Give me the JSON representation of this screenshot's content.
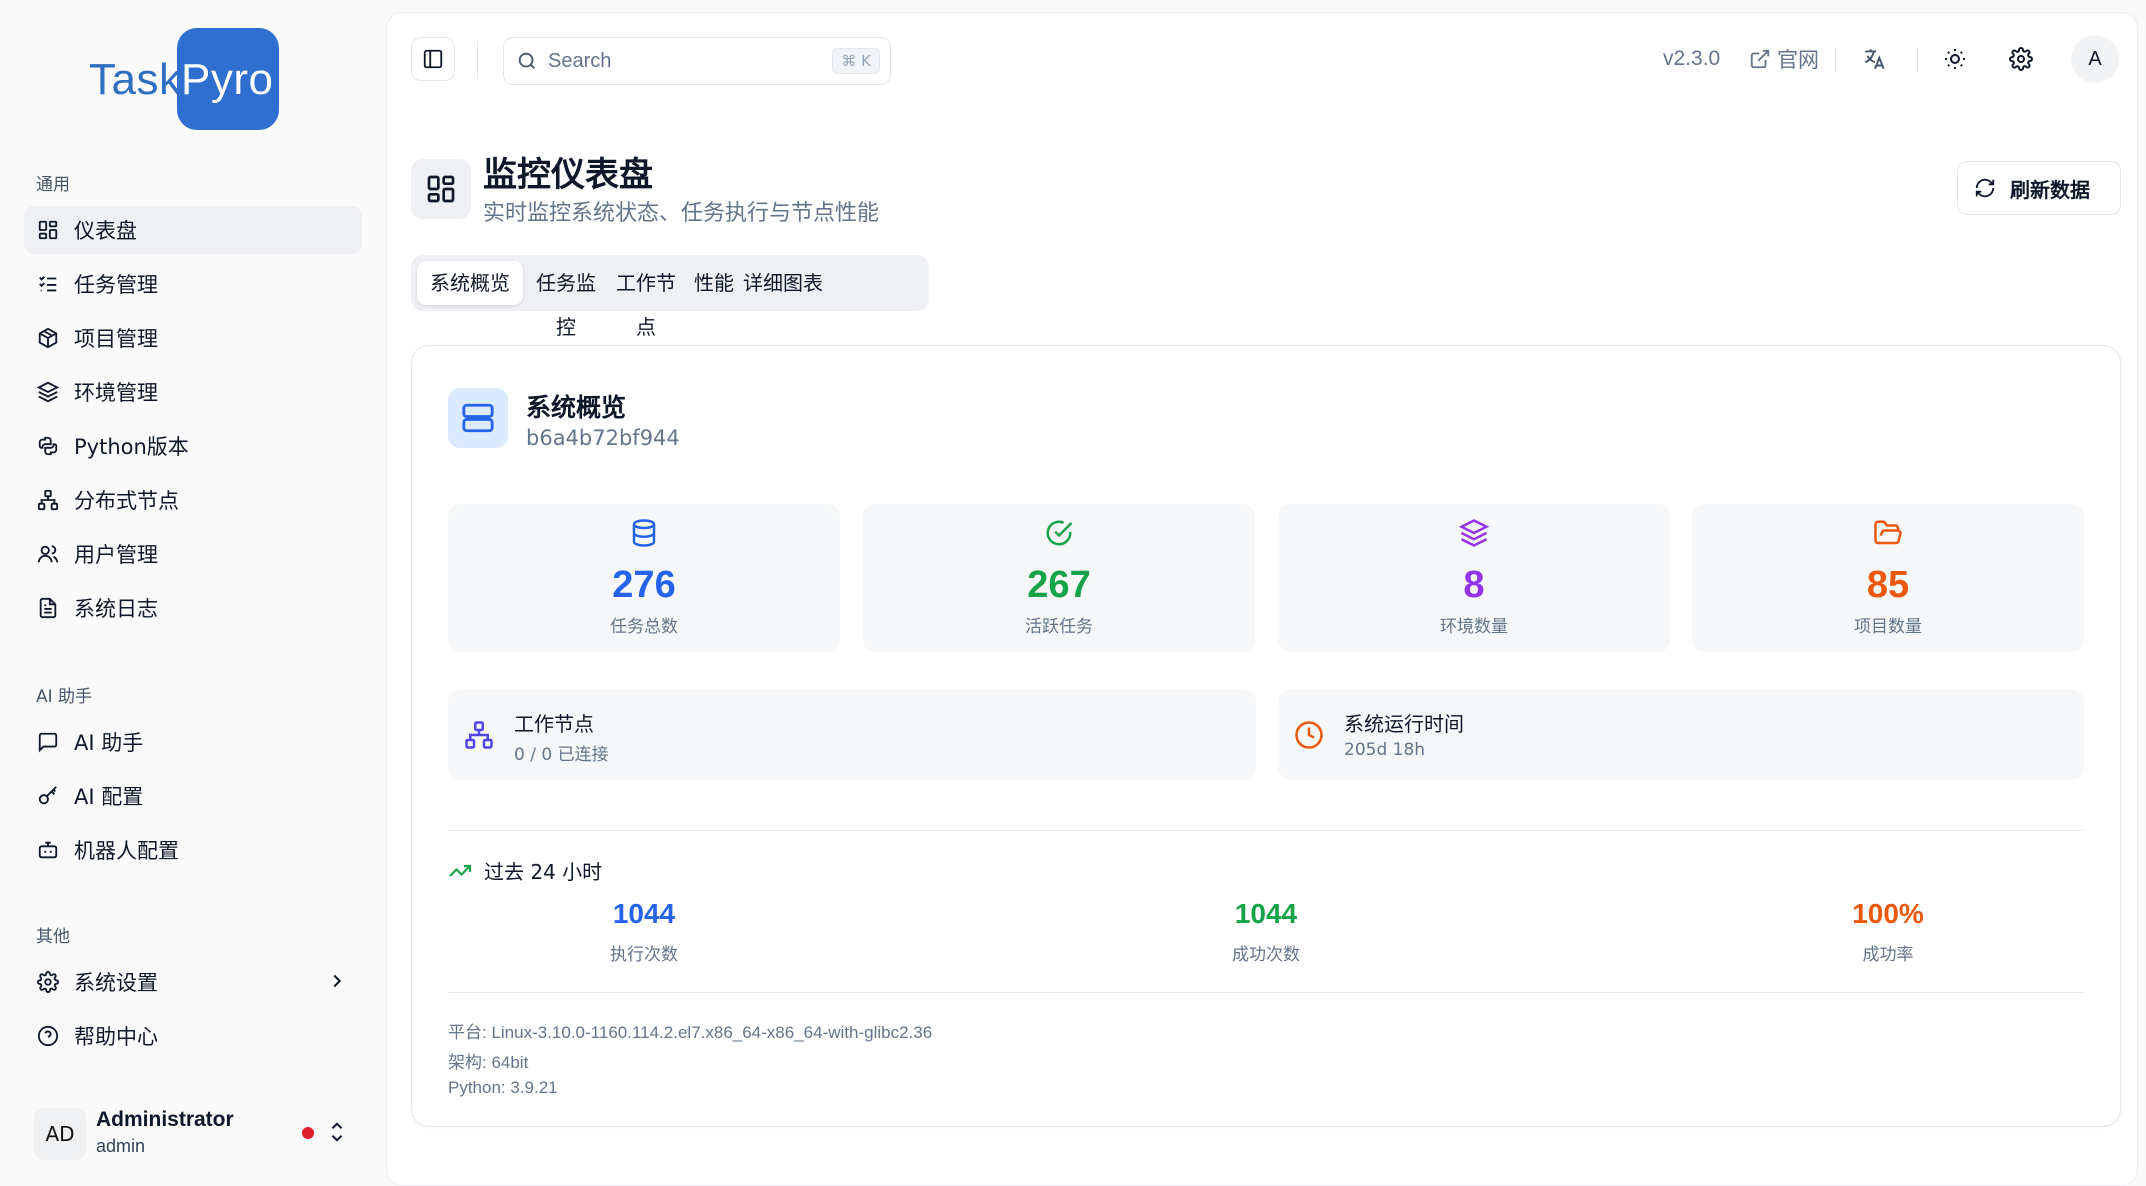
{
  "brand": {
    "part1": "Task",
    "part2": "Pyro"
  },
  "sidebar": {
    "sections": [
      {
        "title": "通用",
        "items": [
          {
            "label": "仪表盘",
            "icon": "dashboard-icon"
          },
          {
            "label": "任务管理",
            "icon": "list-check-icon"
          },
          {
            "label": "项目管理",
            "icon": "package-icon"
          },
          {
            "label": "环境管理",
            "icon": "layers-icon"
          },
          {
            "label": "Python版本",
            "icon": "python-icon"
          },
          {
            "label": "分布式节点",
            "icon": "network-icon"
          },
          {
            "label": "用户管理",
            "icon": "users-icon"
          },
          {
            "label": "系统日志",
            "icon": "file-text-icon"
          }
        ]
      },
      {
        "title": "AI 助手",
        "items": [
          {
            "label": "AI 助手",
            "icon": "message-icon"
          },
          {
            "label": "AI 配置",
            "icon": "key-icon"
          },
          {
            "label": "机器人配置",
            "icon": "bot-icon"
          }
        ]
      },
      {
        "title": "其他",
        "items": [
          {
            "label": "系统设置",
            "icon": "gear-icon"
          },
          {
            "label": "帮助中心",
            "icon": "help-icon"
          }
        ]
      }
    ],
    "user": {
      "initials": "AD",
      "name": "Administrator",
      "role": "admin"
    }
  },
  "topbar": {
    "search_placeholder": "Search",
    "shortcut": "⌘ K",
    "version": "v2.3.0",
    "site_label": "官网",
    "avatar": "A"
  },
  "page": {
    "title": "监控仪表盘",
    "subtitle": "实时监控系统状态、任务执行与节点性能",
    "refresh_label": "刷新数据",
    "tabs": [
      "系统概览",
      "任务监控",
      "工作节点",
      "性能",
      "详细图表"
    ],
    "active_tab": 0
  },
  "overview": {
    "title": "系统概览",
    "id": "b6a4b72bf944",
    "stats": [
      {
        "value": "276",
        "label": "任务总数",
        "color": "#2563eb",
        "icon": "database-icon"
      },
      {
        "value": "267",
        "label": "活跃任务",
        "color": "#16a34a",
        "icon": "check-circle-icon"
      },
      {
        "value": "8",
        "label": "环境数量",
        "color": "#9333ea",
        "icon": "layers-icon"
      },
      {
        "value": "85",
        "label": "项目数量",
        "color": "#ea580c",
        "icon": "folder-open-icon"
      }
    ],
    "workers": {
      "title": "工作节点",
      "value": "0 / 0 已连接"
    },
    "uptime": {
      "title": "系统运行时间",
      "value": "205d 18h"
    },
    "past24": {
      "title": "过去 24 小时",
      "stats": [
        {
          "value": "1044",
          "label": "执行次数",
          "color": "#2563eb"
        },
        {
          "value": "1044",
          "label": "成功次数",
          "color": "#16a34a"
        },
        {
          "value": "100%",
          "label": "成功率",
          "color": "#ea580c"
        }
      ]
    },
    "system": {
      "platform": "平台: Linux-3.10.0-1160.114.2.el7.x86_64-x86_64-with-glibc2.36",
      "arch": "架构: 64bit",
      "python": "Python: 3.9.21"
    }
  }
}
